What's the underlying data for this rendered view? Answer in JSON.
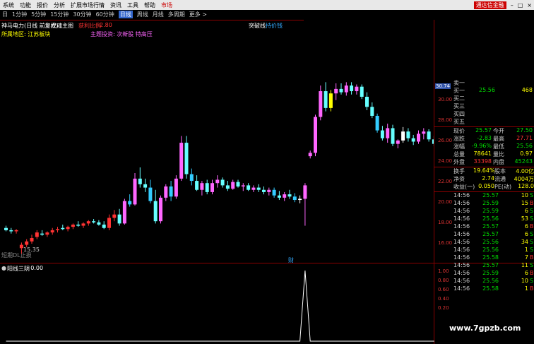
{
  "menu": [
    "系统",
    "功能",
    "报价",
    "分析",
    "扩展市场行情",
    "资讯",
    "工具",
    "帮助"
  ],
  "menu_right": {
    "market": "市场",
    "notify": "通达信金融"
  },
  "periods": [
    "日",
    "1分钟",
    "5分钟",
    "15分钟",
    "30分钟",
    "60分钟",
    "日线",
    "周线",
    "月线",
    "多周期",
    "更多 >"
  ],
  "active_period": "日线",
  "chart": {
    "stock_name": "神马电力(日线 前复权)",
    "main_indicator": "龙魂主图",
    "indicator_value_label": "获利比例",
    "indicator_value": "2.80",
    "breakout_label": "突破线",
    "breakout_value": "持价钱",
    "region_label": "所属地区: 江苏板块",
    "theme_label": "主题投资: 次新股 特高压",
    "low_label": "15.35",
    "bottom_label": "短期DL止损",
    "finance_mark": "财",
    "y_axis_labels": [
      "30.00",
      "28.00",
      "26.00",
      "24.00",
      "22.00",
      "20.00",
      "18.00",
      "16.00"
    ],
    "price_tag": "30.74"
  },
  "indicator_panel": {
    "title": "阳线三阴",
    "value": ": 0.00",
    "y_axis_labels": [
      "1.00",
      "0.80",
      "0.60",
      "0.40",
      "0.20"
    ]
  },
  "chart_data": {
    "type": "candlestick",
    "ylim": [
      15,
      31
    ],
    "candles": [
      [
        17.6,
        17.8,
        17.3,
        17.4
      ],
      [
        17.4,
        17.6,
        17.1,
        17.3
      ],
      [
        17.3,
        17.5,
        17.1,
        17.4
      ],
      [
        15.8,
        16.3,
        15.3,
        16.1
      ],
      [
        16.1,
        16.6,
        15.9,
        16.4
      ],
      [
        16.4,
        17.0,
        16.2,
        16.7
      ],
      [
        16.8,
        17.4,
        16.6,
        17.2
      ],
      [
        17.1,
        17.4,
        16.9,
        17.0
      ],
      [
        17.0,
        17.3,
        16.8,
        17.2
      ],
      [
        17.2,
        17.6,
        17.0,
        17.4
      ],
      [
        17.4,
        17.7,
        17.2,
        17.5
      ],
      [
        17.6,
        17.9,
        17.4,
        17.5
      ],
      [
        17.5,
        17.8,
        17.3,
        17.7
      ],
      [
        17.7,
        18.0,
        17.5,
        17.9
      ],
      [
        17.9,
        18.2,
        17.7,
        17.8
      ],
      [
        17.8,
        18.1,
        17.6,
        18.0
      ],
      [
        18.0,
        18.3,
        17.8,
        18.2
      ],
      [
        18.2,
        18.4,
        18.0,
        18.1
      ],
      [
        18.1,
        18.3,
        17.8,
        17.9
      ],
      [
        17.9,
        18.2,
        17.5,
        17.6
      ],
      [
        17.6,
        18.8,
        17.4,
        18.5
      ],
      [
        18.5,
        19.2,
        18.2,
        18.8
      ],
      [
        18.8,
        19.3,
        17.8,
        18.0
      ],
      [
        18.0,
        20.2,
        17.9,
        20.0
      ],
      [
        20.0,
        20.6,
        19.5,
        19.7
      ],
      [
        19.7,
        22.5,
        19.6,
        22.0
      ],
      [
        22.0,
        23.0,
        21.2,
        21.5
      ],
      [
        21.5,
        22.0,
        20.8,
        21.2
      ],
      [
        21.2,
        21.9,
        19.8,
        20.0
      ],
      [
        20.0,
        21.0,
        18.0,
        18.2
      ],
      [
        18.2,
        20.5,
        18.0,
        20.3
      ],
      [
        20.3,
        21.5,
        20.0,
        21.3
      ],
      [
        21.3,
        21.8,
        20.0,
        20.4
      ],
      [
        20.4,
        22.3,
        20.2,
        22.0
      ],
      [
        22.0,
        25.8,
        21.8,
        25.2
      ],
      [
        25.2,
        25.8,
        22.0,
        22.4
      ],
      [
        22.4,
        22.9,
        21.4,
        21.8
      ],
      [
        21.8,
        22.3,
        20.9,
        21.0
      ],
      [
        21.0,
        21.8,
        20.5,
        21.6
      ],
      [
        21.6,
        21.9,
        20.6,
        20.8
      ],
      [
        20.8,
        21.9,
        20.6,
        21.6
      ],
      [
        21.6,
        22.3,
        21.2,
        21.9
      ],
      [
        21.9,
        22.1,
        21.2,
        21.4
      ],
      [
        21.4,
        21.8,
        20.9,
        21.1
      ],
      [
        21.1,
        21.9,
        21.0,
        21.7
      ],
      [
        21.7,
        21.9,
        21.2,
        21.3
      ],
      [
        21.3,
        21.6,
        20.9,
        21.4
      ],
      [
        21.4,
        21.6,
        20.9,
        21.0
      ],
      [
        21.0,
        21.4,
        20.8,
        21.2
      ],
      [
        21.2,
        21.5,
        20.8,
        21.0
      ],
      [
        21.0,
        21.3,
        20.6,
        20.8
      ],
      [
        20.8,
        21.2,
        20.5,
        21.0
      ],
      [
        21.0,
        21.2,
        20.3,
        20.5
      ],
      [
        20.5,
        20.9,
        20.1,
        20.3
      ],
      [
        20.3,
        20.8,
        20.0,
        20.6
      ],
      [
        20.6,
        21.0,
        20.2,
        20.4
      ],
      [
        20.4,
        20.7,
        19.9,
        20.1
      ],
      [
        20.1,
        20.5,
        19.8,
        20.2
      ],
      [
        20.2,
        21.6,
        17.8,
        21.4
      ],
      [
        24.0,
        24.5,
        23.8,
        24.3
      ],
      [
        24.3,
        27.7,
        24.0,
        27.5
      ],
      [
        27.5,
        30.3,
        27.2,
        29.8
      ],
      [
        29.8,
        30.6,
        28.0,
        28.3
      ],
      [
        28.3,
        29.9,
        28.0,
        29.6
      ],
      [
        29.6,
        30.5,
        29.0,
        30.0
      ],
      [
        30.0,
        30.5,
        29.5,
        29.7
      ],
      [
        29.7,
        30.6,
        29.4,
        30.3
      ],
      [
        30.3,
        30.6,
        29.5,
        29.8
      ],
      [
        29.8,
        30.4,
        29.5,
        30.2
      ],
      [
        30.2,
        30.4,
        29.1,
        29.3
      ],
      [
        29.3,
        29.7,
        28.1,
        28.4
      ],
      [
        28.4,
        28.8,
        27.4,
        27.6
      ],
      [
        27.6,
        27.8,
        26.1,
        26.3
      ],
      [
        26.3,
        26.7,
        25.4,
        25.6
      ],
      [
        25.6,
        26.9,
        25.2,
        26.5
      ],
      [
        26.5,
        26.8,
        24.9,
        25.1
      ],
      [
        25.1,
        25.5,
        24.7,
        25.4
      ],
      [
        25.4,
        26.6,
        25.2,
        26.2
      ],
      [
        26.2,
        26.5,
        25.3,
        25.6
      ],
      [
        25.6,
        25.9,
        25.0,
        25.3
      ],
      [
        25.3,
        26.3,
        25.1,
        26.0
      ],
      [
        26.0,
        26.5,
        25.5,
        26.2
      ],
      [
        26.2,
        26.4,
        25.3,
        25.5
      ],
      [
        25.5,
        25.8,
        24.9,
        25.1
      ],
      [
        25.1,
        25.5,
        24.4,
        24.6
      ]
    ],
    "indicator_ylim": [
      0,
      1
    ],
    "indicator_spike_index": 58
  },
  "quote": {
    "order_book": [
      {
        "label": "卖一",
        "price": "",
        "vol": ""
      },
      {
        "label": "买一",
        "price": "25.56",
        "vol": "468"
      },
      {
        "label": "买二",
        "price": "",
        "vol": ""
      },
      {
        "label": "买三",
        "price": "",
        "vol": ""
      },
      {
        "label": "买四",
        "price": "",
        "vol": ""
      },
      {
        "label": "买五",
        "price": "",
        "vol": ""
      }
    ],
    "stats": [
      {
        "l1": "现价",
        "v1": "25.57",
        "l2": "今开",
        "v2": "27.50",
        "c1": "#00dd00",
        "c2": "#00dd00"
      },
      {
        "l1": "涨跌",
        "v1": "-2.83",
        "l2": "最高",
        "v2": "27.71",
        "c1": "#00dd00",
        "c2": "#ff3333"
      },
      {
        "l1": "涨幅",
        "v1": "-9.96%",
        "l2": "最低",
        "v2": "25.56",
        "c1": "#00dd00",
        "c2": "#00dd00"
      },
      {
        "l1": "总量",
        "v1": "78641",
        "l2": "量比",
        "v2": "0.97",
        "c1": "#ffff00",
        "c2": "#ffff00"
      },
      {
        "l1": "外盘",
        "v1": "33398",
        "l2": "内盘",
        "v2": "45243",
        "c1": "#ff3333",
        "c2": "#00dd00"
      }
    ],
    "stats2": [
      {
        "l1": "换手",
        "v1": "19.64%",
        "l2": "股本",
        "v2": "4.00亿",
        "c1": "#ffff00",
        "c2": "#ffff00"
      },
      {
        "l1": "净资",
        "v1": "2.74",
        "l2": "流通",
        "v2": "4004万",
        "c1": "#ffff00",
        "c2": "#ffff00"
      },
      {
        "l1": "收益(一)",
        "v1": "0.050",
        "l2": "PE(动)",
        "v2": "128.0",
        "c1": "#ffff00",
        "c2": "#ffff00"
      }
    ],
    "trades": [
      {
        "time": "14:56",
        "price": "25.57",
        "vol": "10",
        "side": "S",
        "pc": "#00dd00",
        "sc": "#00dd00"
      },
      {
        "time": "14:56",
        "price": "25.59",
        "vol": "15",
        "side": "B",
        "pc": "#00dd00",
        "sc": "#ff3333"
      },
      {
        "time": "14:56",
        "price": "25.59",
        "vol": "6",
        "side": "S",
        "pc": "#00dd00",
        "sc": "#00dd00"
      },
      {
        "time": "14:56",
        "price": "25.56",
        "vol": "53",
        "side": "S",
        "pc": "#00dd00",
        "sc": "#00dd00"
      },
      {
        "time": "14:56",
        "price": "25.57",
        "vol": "6",
        "side": "B",
        "pc": "#00dd00",
        "sc": "#ff3333"
      },
      {
        "time": "14:56",
        "price": "25.57",
        "vol": "6",
        "side": "S",
        "pc": "#00dd00",
        "sc": "#00dd00"
      },
      {
        "time": "14:56",
        "price": "25.56",
        "vol": "34",
        "side": "S",
        "pc": "#00dd00",
        "sc": "#00dd00"
      },
      {
        "time": "14:56",
        "price": "25.56",
        "vol": "1",
        "side": "S",
        "pc": "#00dd00",
        "sc": "#00dd00"
      },
      {
        "time": "14:56",
        "price": "25.58",
        "vol": "7",
        "side": "B",
        "pc": "#00dd00",
        "sc": "#ff3333"
      },
      {
        "time": "14:56",
        "price": "25.57",
        "vol": "11",
        "side": "S",
        "pc": "#00dd00",
        "sc": "#00dd00"
      },
      {
        "time": "14:56",
        "price": "25.59",
        "vol": "6",
        "side": "B",
        "pc": "#00dd00",
        "sc": "#ff3333"
      },
      {
        "time": "14:56",
        "price": "25.56",
        "vol": "10",
        "side": "S",
        "pc": "#00dd00",
        "sc": "#00dd00"
      },
      {
        "time": "14:56",
        "price": "25.58",
        "vol": "1",
        "side": "B",
        "pc": "#00dd00",
        "sc": "#ff3333"
      }
    ]
  },
  "watermark": "www.7gpzb.com"
}
